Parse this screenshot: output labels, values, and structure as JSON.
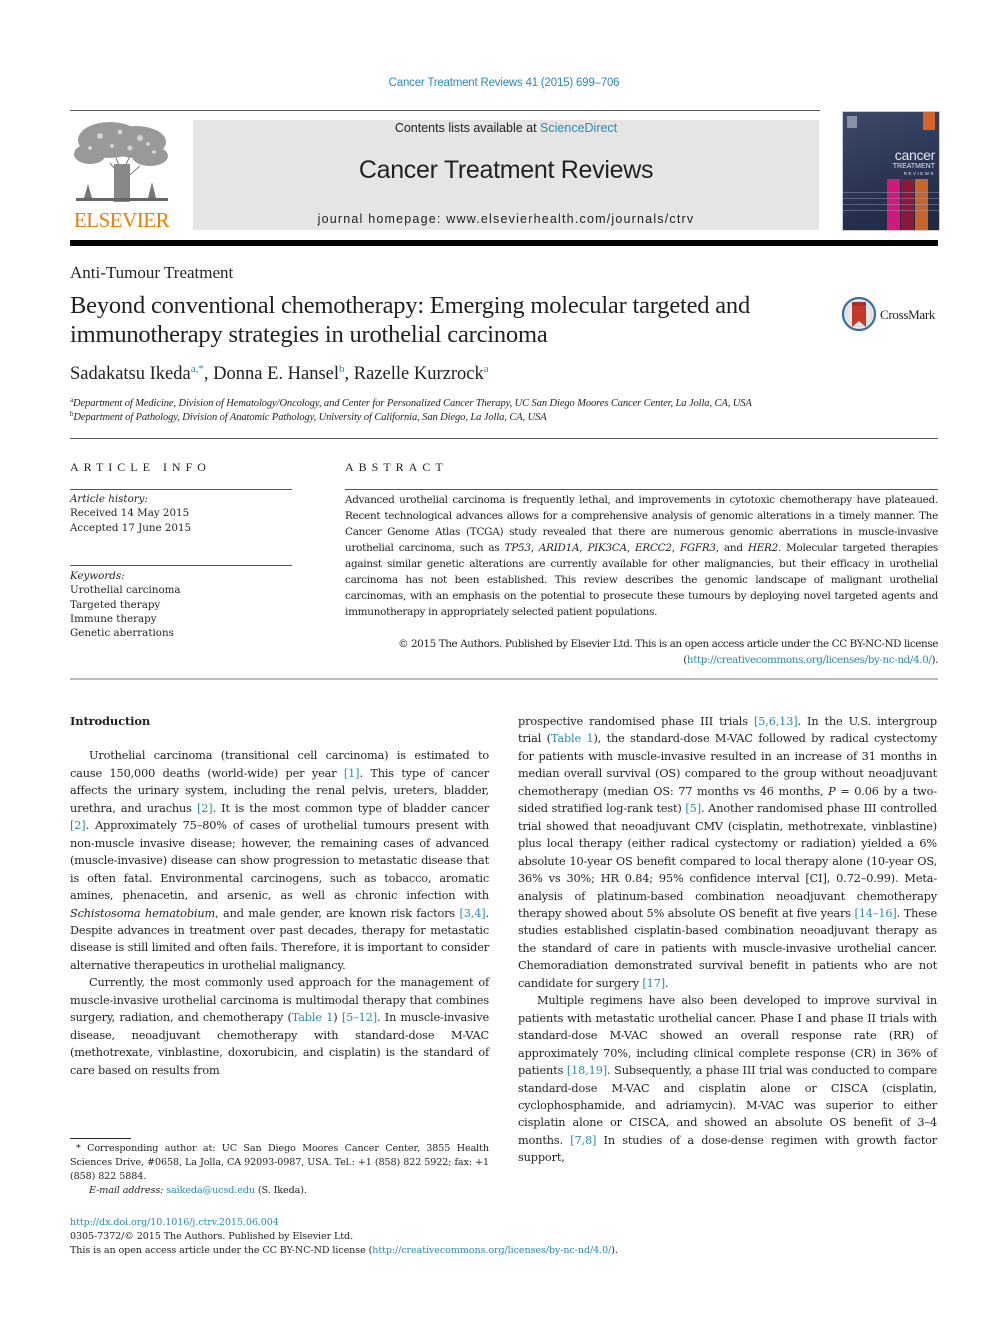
{
  "header": {
    "citation": "Cancer Treatment Reviews 41 (2015) 699–706",
    "contents_prefix": "Contents lists available at ",
    "contents_link": "ScienceDirect",
    "journal_name": "Cancer Treatment Reviews",
    "homepage": "journal homepage: www.elsevierhealth.com/journals/ctrv",
    "publisher_logo": "ELSEVIER",
    "cover": {
      "line1": "cancer",
      "line2": "TREATMENT",
      "line3": "REVIEWS",
      "colors": [
        "#d1187b",
        "#8b1a3a",
        "#c8662a"
      ]
    }
  },
  "article": {
    "section": "Anti-Tumour Treatment",
    "title": "Beyond conventional chemotherapy: Emerging molecular targeted and immunotherapy strategies in urothelial carcinoma",
    "crossmark_label": "CrossMark",
    "authors": [
      {
        "name": "Sadakatsu Ikeda",
        "sup": "a,*"
      },
      {
        "name": "Donna E. Hansel",
        "sup": "b"
      },
      {
        "name": "Razelle Kurzrock",
        "sup": "a"
      }
    ],
    "affiliations": [
      {
        "sup": "a",
        "text": "Department of Medicine, Division of Hematology/Oncology, and Center for Personalized Cancer Therapy, UC San Diego Moores Cancer Center, La Jolla, CA, USA"
      },
      {
        "sup": "b",
        "text": "Department of Pathology, Division of Anatomic Pathology, University of California, San Diego, La Jolla, CA, USA"
      }
    ]
  },
  "article_info": {
    "heading": "ARTICLE INFO",
    "history_label": "Article history:",
    "received": "Received 14 May 2015",
    "accepted": "Accepted 17 June 2015",
    "keywords_label": "Keywords:",
    "keywords": [
      "Urothelial carcinoma",
      "Targeted therapy",
      "Immune therapy",
      "Genetic aberrations"
    ]
  },
  "abstract": {
    "heading": "ABSTRACT",
    "p1": "Advanced urothelial carcinoma is frequently lethal, and improvements in cytotoxic chemotherapy have plateaued. Recent technological advances allows for a comprehensive analysis of genomic alterations in a timely manner. The Cancer Genome Atlas (TCGA) study revealed that there are numerous genomic aberrations in muscle-invasive urothelial carcinoma, such as ",
    "genes": [
      "TP53",
      "ARID1A",
      "PIK3CA",
      "ERCC2",
      "FGFR3",
      "HER2"
    ],
    "p2": ". Molecular targeted therapies against similar genetic alterations are currently available for other malignancies, but their efficacy in urothelial carcinoma has not been established. This review describes the genomic landscape of malignant urothelial carcinomas, with an emphasis on the potential to prosecute these tumours by deploying novel targeted agents and immunotherapy in appropriately selected patient populations.",
    "copyright": "© 2015 The Authors. Published by Elsevier Ltd. This is an open access article under the CC BY-NC-ND license",
    "license_url": "http://creativecommons.org/licenses/by-nc-nd/4.0/"
  },
  "body": {
    "intro_heading": "Introduction",
    "left_p1": [
      {
        "t": "Urothelial carcinoma (transitional cell carcinoma) is estimated to cause 150,000 deaths (world-wide) per year "
      },
      {
        "ref": "[1]"
      },
      {
        "t": ". This type of cancer affects the urinary system, including the renal pelvis, ureters, bladder, urethra, and urachus "
      },
      {
        "ref": "[2]"
      },
      {
        "t": ". It is the most common type of bladder cancer "
      },
      {
        "ref": "[2]"
      },
      {
        "t": ". Approximately 75–80% of cases of urothelial tumours present with non-muscle invasive disease; however, the remaining cases of advanced (muscle-invasive) disease can show progression to metastatic disease that is often fatal. Environmental carcinogens, such as tobacco, aromatic amines, phenacetin, and arsenic, as well as chronic infection with "
      },
      {
        "i": "Schistosoma hematobium"
      },
      {
        "t": ", and male gender, are known risk factors "
      },
      {
        "ref": "[3,4]"
      },
      {
        "t": ". Despite advances in treatment over past decades, therapy for metastatic disease is still limited and often fails. Therefore, it is important to consider alternative therapeutics in urothelial malignancy."
      }
    ],
    "left_p2": [
      {
        "t": "Currently, the most commonly used approach for the management of muscle-invasive urothelial carcinoma is multimodal therapy that combines surgery, radiation, and chemotherapy ("
      },
      {
        "ref": "Table 1"
      },
      {
        "t": ") "
      },
      {
        "ref": "[5–12]"
      },
      {
        "t": ". In muscle-invasive disease, neoadjuvant chemotherapy with standard-dose M-VAC (methotrexate, vinblastine, doxorubicin, and cisplatin) is the standard of care based on results from"
      }
    ],
    "right_p1": [
      {
        "t": "prospective randomised phase III trials "
      },
      {
        "ref": "[5,6,13]"
      },
      {
        "t": ". In the U.S. intergroup trial ("
      },
      {
        "ref": "Table 1"
      },
      {
        "t": "), the standard-dose M-VAC followed by radical cystectomy for patients with muscle-invasive resulted in an increase of 31 months in median overall survival (OS) compared to the group without neoadjuvant chemotherapy (median OS: 77 months vs 46 months, "
      },
      {
        "i": "P"
      },
      {
        "t": " = 0.06 by a two-sided stratified log-rank test) "
      },
      {
        "ref": "[5]"
      },
      {
        "t": ". Another randomised phase III controlled trial showed that neoadjuvant CMV (cisplatin, methotrexate, vinblastine) plus local therapy (either radical cystectomy or radiation) yielded a 6% absolute 10-year OS benefit compared to local therapy alone (10-year OS, 36% vs 30%; HR 0.84; 95% confidence interval [CI], 0.72–0.99). Meta-analysis of platinum-based combination neoadjuvant chemotherapy therapy showed about 5% absolute OS benefit at five years "
      },
      {
        "ref": "[14–16]"
      },
      {
        "t": ". These studies established cisplatin-based combination neoadjuvant therapy as the standard of care in patients with muscle-invasive urothelial cancer. Chemoradiation demonstrated survival benefit in patients who are not candidate for surgery "
      },
      {
        "ref": "[17]"
      },
      {
        "t": "."
      }
    ],
    "right_p2": [
      {
        "t": "Multiple regimens have also been developed to improve survival in patients with metastatic urothelial cancer. Phase I and phase II trials with standard-dose M-VAC showed an overall response rate (RR) of approximately 70%, including clinical complete response (CR) in 36% of patients "
      },
      {
        "ref": "[18,19]"
      },
      {
        "t": ". Subsequently, a phase III trial was conducted to compare standard-dose M-VAC and cisplatin alone or CISCA (cisplatin, cyclophosphamide, and adriamycin). M-VAC was superior to either cisplatin alone or CISCA, and showed an absolute OS benefit of 3–4 months. "
      },
      {
        "ref": "[7,8]"
      },
      {
        "t": " In studies of a dose-dense regimen with growth factor support,"
      }
    ]
  },
  "footnotes": {
    "corresponding": "* Corresponding author at: UC San Diego Moores Cancer Center, 3855 Health Sciences Drive, #0658, La Jolla, CA 92093-0987, USA. Tel.: +1 (858) 822 5922; fax: +1 (858) 822 5884.",
    "email_label": "E-mail address: ",
    "email": "saikeda@ucsd.edu",
    "email_suffix": " (S. Ikeda)."
  },
  "bottom": {
    "doi": "http://dx.doi.org/10.1016/j.ctrv.2015.06.004",
    "issn_line": "0305-7372/© 2015 The Authors. Published by Elsevier Ltd.",
    "license_prefix": "This is an open access article under the CC BY-NC-ND license (",
    "license_url": "http://creativecommons.org/licenses/by-nc-nd/4.0/",
    "license_suffix": ")."
  },
  "colors": {
    "link": "#2a8bb3",
    "elsevier_orange": "#f07c00",
    "masthead_bg": "#e5e5e5"
  }
}
